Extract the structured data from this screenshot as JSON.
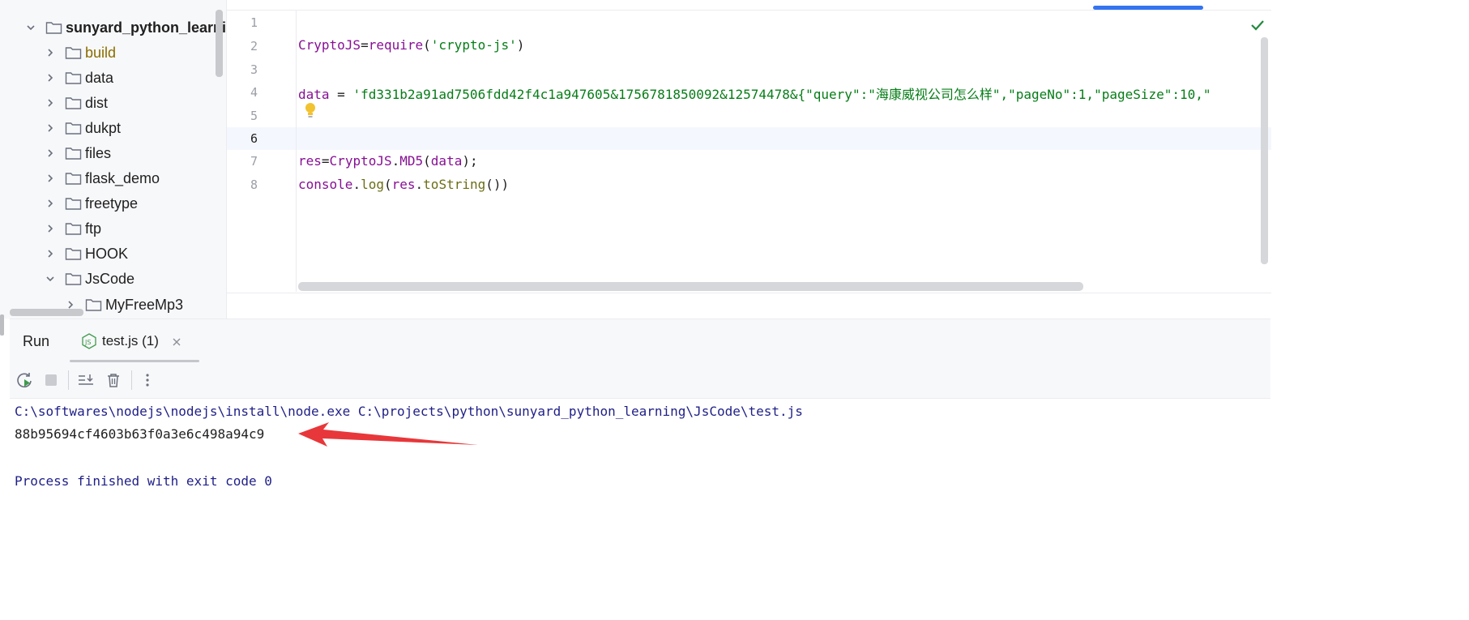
{
  "project_tree": {
    "root": "sunyard_python_learning",
    "items": [
      {
        "label": "build",
        "expanded": false
      },
      {
        "label": "data",
        "expanded": false
      },
      {
        "label": "dist",
        "expanded": false
      },
      {
        "label": "dukpt",
        "expanded": false
      },
      {
        "label": "files",
        "expanded": false
      },
      {
        "label": "flask_demo",
        "expanded": false
      },
      {
        "label": "freetype",
        "expanded": false
      },
      {
        "label": "ftp",
        "expanded": false
      },
      {
        "label": "HOOK",
        "expanded": false
      },
      {
        "label": "JsCode",
        "expanded": true
      }
    ],
    "child": "MyFreeMp3"
  },
  "editor": {
    "line_numbers": [
      "1",
      "2",
      "3",
      "4",
      "5",
      "6",
      "7",
      "8"
    ],
    "line2": {
      "a": "CryptoJS",
      "b": "=",
      "c": "require",
      "d": "(",
      "e": "'crypto-js'",
      "f": ")"
    },
    "line4": {
      "a": "data",
      "b": " = ",
      "c": "'fd331b2a91ad7506fdd42f4c1a947605&1756781850092&12574478&{\"query\":\"海康威视公司怎么样\",\"pageNo\":1,\"pageSize\":10,\""
    },
    "line7": {
      "a": "res",
      "b": "=",
      "c": "CryptoJS",
      "d": ".",
      "e": "MD5",
      "f": "(",
      "g": "data",
      "h": ");"
    },
    "line8": {
      "a": "console",
      "b": ".",
      "c": "log",
      "d": "(",
      "e": "res",
      "f": ".",
      "g": "toString",
      "h": "())"
    }
  },
  "run_panel": {
    "title": "Run",
    "tab_label": "test.js (1)",
    "tab_icon": "js-file-icon",
    "console": {
      "command": "C:\\softwares\\nodejs\\nodejs\\install\\node.exe C:\\projects\\python\\sunyard_python_learning\\JsCode\\test.js",
      "output": "88b95694cf4603b63f0a3e6c498a94c9",
      "finish": "Process finished with exit code 0"
    }
  },
  "colors": {
    "accent": "#3574f0",
    "annotation_arrow": "#e8373a",
    "keyword_purple": "#871094",
    "string_green": "#067d17",
    "console_blue": "#1f1f88"
  }
}
